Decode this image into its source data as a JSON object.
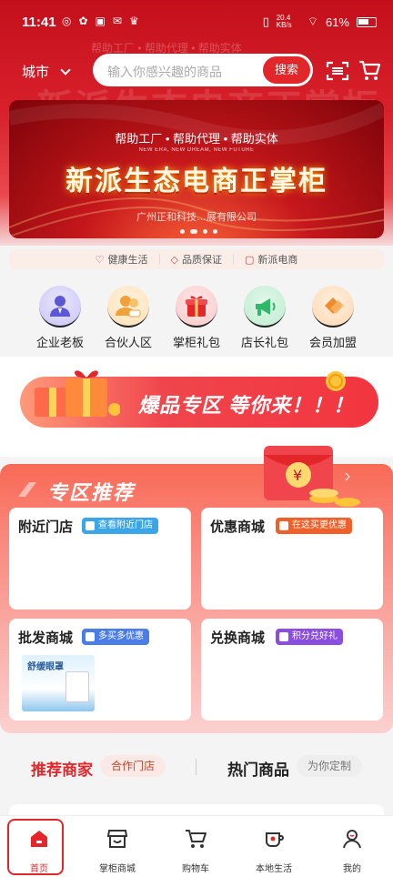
{
  "status_bar": {
    "time": "11:41",
    "network": "20.4 KB/s",
    "battery": "61%"
  },
  "header": {
    "city": "城市",
    "search_placeholder": "输入你感兴趣的商品",
    "search_button": "搜索"
  },
  "banner": {
    "subtitle": "帮助工厂 • 帮助代理 • 帮助实体",
    "english": "NEW ERA, NEW DREAM, NEW FUTURE",
    "title": "新派生态电商正掌柜",
    "company": "广州正和科技…展有限公司"
  },
  "guarantees": [
    "健康生活",
    "品质保证",
    "新派电商"
  ],
  "categories": [
    {
      "label": "企业老板",
      "icon": "boss-icon",
      "color": "#5b57d6"
    },
    {
      "label": "合伙人区",
      "icon": "partner-icon",
      "color": "#f2a03a"
    },
    {
      "label": "掌柜礼包",
      "icon": "gift-icon",
      "color": "#e3262a"
    },
    {
      "label": "店长礼包",
      "icon": "megaphone-icon",
      "color": "#2fb86a"
    },
    {
      "label": "会员加盟",
      "icon": "diamond-icon",
      "color": "#f08a2c"
    }
  ],
  "promo": {
    "text": "爆品专区 等你来！！！"
  },
  "zone": {
    "title": "专区推荐",
    "cards": [
      {
        "title": "附近门店",
        "tag": "查看附近门店",
        "tag_color": "#3aa6e8"
      },
      {
        "title": "优惠商城",
        "tag": "在这买更优惠",
        "tag_color": "#f0602a"
      },
      {
        "title": "批发商城",
        "tag": "多买多优惠",
        "tag_color": "#4a7de8",
        "product": "舒缓眼罩"
      },
      {
        "title": "兑换商城",
        "tag": "积分兑好礼",
        "tag_color": "#8a4ee0"
      }
    ]
  },
  "recommend": {
    "left": "推荐商家",
    "left_badge": "合作门店",
    "right": "热门商品",
    "right_badge": "为你定制"
  },
  "tabs": [
    {
      "label": "首页",
      "icon": "home-icon"
    },
    {
      "label": "掌柜商城",
      "icon": "shop-icon"
    },
    {
      "label": "购物车",
      "icon": "cart-icon"
    },
    {
      "label": "本地生活",
      "icon": "coffee-icon"
    },
    {
      "label": "我的",
      "icon": "user-icon"
    }
  ],
  "accent": "#e3262a"
}
